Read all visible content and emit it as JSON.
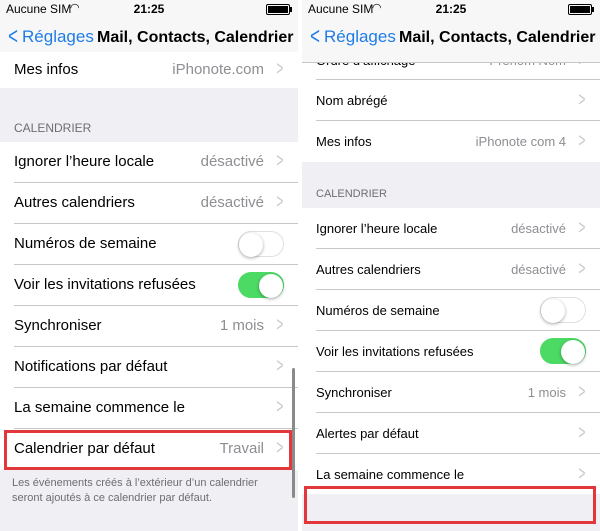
{
  "status": {
    "carrier": "Aucune SIM",
    "time": "21:25",
    "wifi_icon": "wifi-icon",
    "battery_icon": "battery-icon"
  },
  "nav": {
    "back_label": "Réglages",
    "title": "Mail, Contacts, Calendrier"
  },
  "left": {
    "rows_top": [
      {
        "label": "Mes infos",
        "value": "iPhonote.com"
      }
    ],
    "section_header": "CALENDRIER",
    "rows": [
      {
        "label": "Ignorer l’heure locale",
        "value": "désactivé",
        "type": "arrow"
      },
      {
        "label": "Autres calendriers",
        "value": "désactivé",
        "type": "arrow"
      },
      {
        "label": "Numéros de semaine",
        "type": "switch",
        "on": false
      },
      {
        "label": "Voir les invitations refusées",
        "type": "switch",
        "on": true
      },
      {
        "label": "Synchroniser",
        "value": "1 mois",
        "type": "arrow"
      },
      {
        "label": "Notifications par défaut",
        "type": "arrow"
      },
      {
        "label": "La semaine commence le",
        "type": "arrow"
      },
      {
        "label": "Calendrier par défaut",
        "value": "Travail",
        "type": "arrow"
      }
    ],
    "footnote": "Les événements créés à l’extérieur d’un calendrier seront ajoutés à ce calendrier par défaut."
  },
  "right": {
    "rows_top": [
      {
        "label": "Ordre d’affichage",
        "value": "Prénom Nom",
        "type": "arrow"
      },
      {
        "label": "Nom abrégé",
        "type": "arrow"
      },
      {
        "label": "Mes infos",
        "value": "iPhonote com 4",
        "type": "arrow"
      }
    ],
    "section_header": "CALENDRIER",
    "rows": [
      {
        "label": "Ignorer l’heure locale",
        "value": "désactivé",
        "type": "arrow"
      },
      {
        "label": "Autres calendriers",
        "value": "désactivé",
        "type": "arrow"
      },
      {
        "label": "Numéros de semaine",
        "type": "switch",
        "on": false
      },
      {
        "label": "Voir les invitations refusées",
        "type": "switch",
        "on": true
      },
      {
        "label": "Synchroniser",
        "value": "1 mois",
        "type": "arrow"
      },
      {
        "label": "Alertes par défaut",
        "type": "arrow"
      },
      {
        "label": "La semaine commence le",
        "type": "arrow"
      }
    ]
  },
  "colors": {
    "accent": "#1f7ce6",
    "switch_on": "#4cd964",
    "highlight": "#e2383c"
  }
}
